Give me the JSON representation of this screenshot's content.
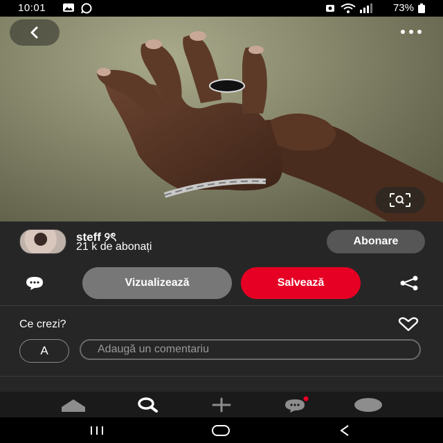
{
  "status_bar": {
    "time": "10:01",
    "battery": "73%"
  },
  "pin": {
    "image_alt": "Hands wearing a black ring and a twisted silver bracelet",
    "back_icon": "chevron-left-icon",
    "more_icon": "more-horizontal-icon",
    "lens_icon": "visual-search-icon"
  },
  "creator": {
    "name": "steff ୨ৎ",
    "subscribers": "21 k de abonați",
    "follow_label": "Abonare"
  },
  "actions": {
    "view_label": "Vizualizează",
    "save_label": "Salvează"
  },
  "comments": {
    "prompt": "Ce crezi?",
    "user_initial": "A",
    "placeholder": "Adaugă un comentariu"
  },
  "colors": {
    "save": "#e60023",
    "panel": "#262626",
    "notification_dot": "#e60023"
  }
}
